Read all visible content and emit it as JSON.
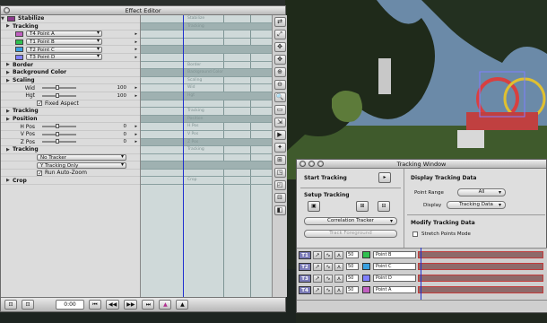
{
  "effect_editor": {
    "title": "Effect Editor",
    "params": [
      {
        "kind": "header",
        "label": "Stabilize"
      },
      {
        "kind": "section",
        "label": "Tracking"
      },
      {
        "kind": "point",
        "label": "T4 Point A",
        "color": "#c060c0"
      },
      {
        "kind": "point",
        "label": "T1 Point B",
        "color": "#2fc050"
      },
      {
        "kind": "point",
        "label": "T2 Point C",
        "color": "#3aa0e0"
      },
      {
        "kind": "point",
        "label": "T3 Point D",
        "color": "#8080ff"
      },
      {
        "kind": "section",
        "label": "Border"
      },
      {
        "kind": "section",
        "label": "Background Color"
      },
      {
        "kind": "section",
        "label": "Scaling"
      },
      {
        "kind": "slider",
        "label": "Wid",
        "value": "100"
      },
      {
        "kind": "slider",
        "label": "Hgt",
        "value": "100"
      },
      {
        "kind": "check",
        "label": "Fixed Aspect"
      },
      {
        "kind": "section",
        "label": "Tracking"
      },
      {
        "kind": "section",
        "label": "Position"
      },
      {
        "kind": "slider",
        "label": "H Pos",
        "value": "0"
      },
      {
        "kind": "slider",
        "label": "V Pos",
        "value": "0"
      },
      {
        "kind": "slider",
        "label": "Z Pos",
        "value": "0"
      },
      {
        "kind": "section",
        "label": "Tracking"
      },
      {
        "kind": "dd",
        "label": "No Tracker"
      },
      {
        "kind": "dd",
        "label": "Y Tracking Only"
      },
      {
        "kind": "check",
        "label": "Run Auto-Zoom"
      },
      {
        "kind": "section",
        "label": "Crop"
      }
    ],
    "timeline_labels": [
      "Stabilize",
      "Tracking",
      "",
      "",
      "",
      "",
      "Border",
      "Background Color",
      "Scaling",
      "Wid",
      "Hgt",
      "",
      "Tracking",
      "Position",
      "H Pos",
      "V Pos",
      "Z Pos",
      "Tracking",
      "",
      "",
      "",
      "Crop"
    ],
    "tools": [
      "⇄",
      "⤢",
      "✥",
      "✥",
      "⊕",
      "⊖",
      "🔍",
      "▭",
      "⇲",
      "▶",
      "✦",
      "⊞",
      "◳",
      "◰",
      "⊟",
      "◧"
    ],
    "bottom": {
      "timecode": "0:00",
      "buttons": [
        "⊡",
        "⊡",
        "⏮",
        "◀◀",
        "▶▶",
        "⏭",
        "▲",
        "▲"
      ]
    }
  },
  "tracking_window": {
    "title": "Tracking Window",
    "start_tracking": "Start Tracking",
    "setup_tracking": "Setup Tracking",
    "correlation_tracker": "Correlation Tracker",
    "track_foreground": "Track Foreground",
    "display_tracking_data": "Display Tracking Data",
    "point_range_label": "Point Range",
    "point_range_value": "All",
    "display_label": "Display",
    "display_value": "Tracking Data",
    "modify_tracking_data": "Modify Tracking Data",
    "stretch_points_mode": "Stretch Points Mode",
    "tracks": [
      {
        "name": "T1",
        "value": "50",
        "point": "Point B",
        "color": "#2fc050"
      },
      {
        "name": "T2",
        "value": "50",
        "point": "Point C",
        "color": "#3aa0e0"
      },
      {
        "name": "T3",
        "value": "50",
        "point": "Point D",
        "color": "#8080ff"
      },
      {
        "name": "T4",
        "value": "50",
        "point": "Point A",
        "color": "#c060c0"
      }
    ]
  }
}
